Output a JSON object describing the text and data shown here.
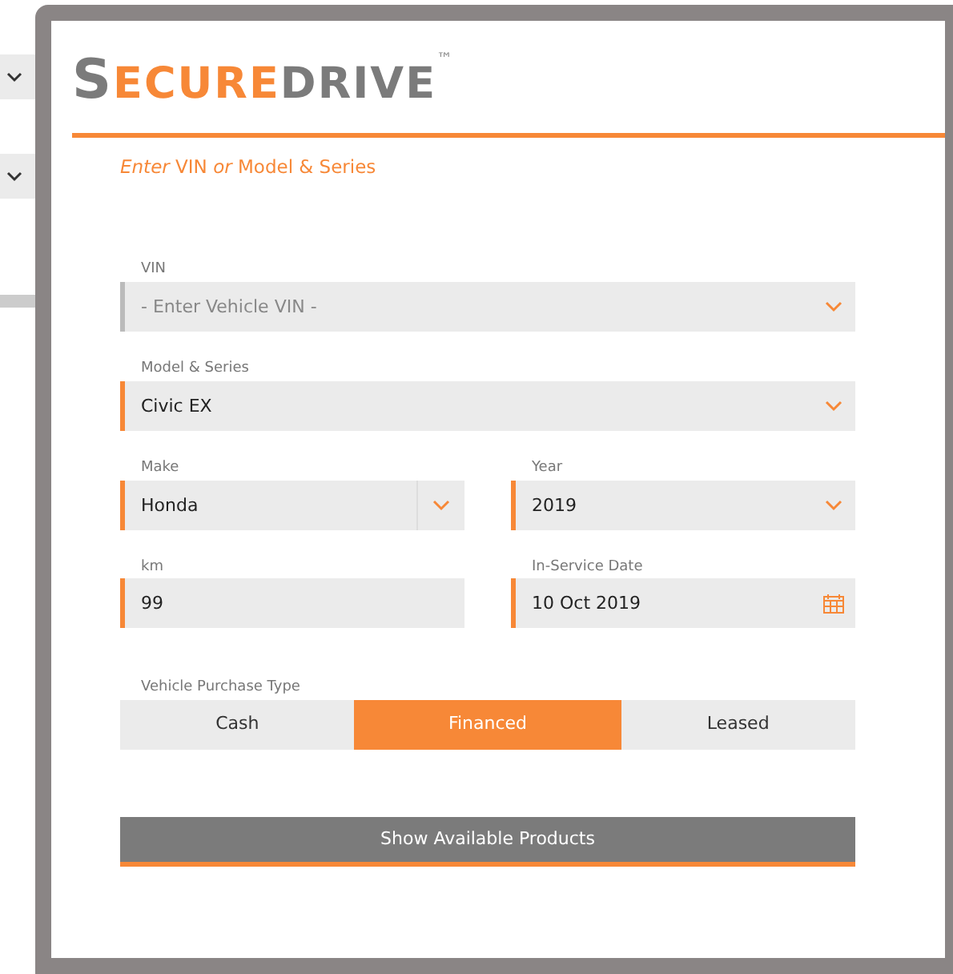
{
  "logo": {
    "first_letter": "S",
    "secure": "ECURE",
    "drive": "DRIVE",
    "trademark": "™"
  },
  "heading": "*Enter* VIN *or* Model & Series",
  "field_rows": [
    {
      "fields": [
        {
          "label": "VIN",
          "placeholder": "- Enter Vehicle VIN -",
          "kind": "select"
        }
      ]
    },
    {
      "fields": [
        {
          "label": "Model & Series",
          "value": "Civic EX",
          "kind": "select"
        }
      ]
    },
    {
      "fields": [
        {
          "label": "Make",
          "value": "Honda",
          "kind": "split-select"
        },
        {
          "label": "Year",
          "value": "2019",
          "kind": "select"
        }
      ]
    },
    {
      "fields": [
        {
          "label": "km",
          "value": "99",
          "kind": "text"
        },
        {
          "label": "In-Service Date",
          "value": "10 Oct 2019",
          "kind": "date"
        }
      ]
    }
  ],
  "purchase_type": {
    "label": "Vehicle Purchase Type",
    "options": [
      {
        "label": "Cash",
        "selected": false
      },
      {
        "label": "Financed",
        "selected": true
      },
      {
        "label": "Leased",
        "selected": false
      }
    ]
  },
  "submit_button": "Show Available Products"
}
